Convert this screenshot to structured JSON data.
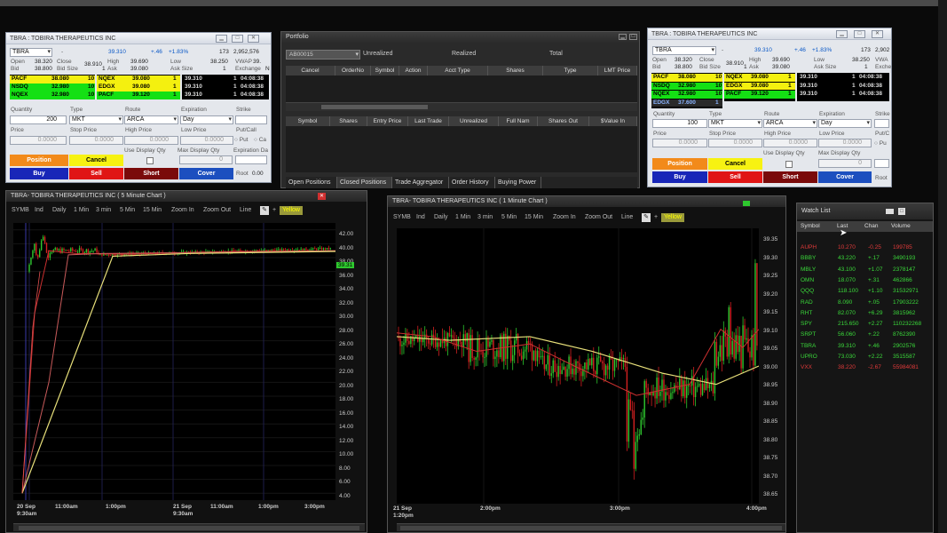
{
  "ticket1": {
    "title": "TBRA : TOBIRA THERAPEUTICS INC",
    "symbol": "TBRA",
    "price": "39.310",
    "change": "+.46",
    "change_pct": "+1.83%",
    "count": "173",
    "volume": "2,952,576",
    "open_label": "Open",
    "open": "38.320",
    "close_label": "Close",
    "close": "38.910",
    "high_label": "High",
    "high": "39.690",
    "low_label": "Low",
    "low": "38.250",
    "vwap_label": "VWAP",
    "vwap": "39.",
    "bid_label": "Bid",
    "bid": "38.800",
    "bidsize_label": "Bid Size",
    "bidsize": "1",
    "ask_label": "Ask",
    "ask": "39.080",
    "asksize_label": "Ask Size",
    "asksize": "1",
    "exch_label": "Exchange",
    "exch": "N",
    "bids": [
      {
        "ex": "PACF",
        "p": "38.080",
        "s": "10"
      },
      {
        "ex": "NSDQ",
        "p": "32.980",
        "s": "10"
      },
      {
        "ex": "NQEX",
        "p": "32.980",
        "s": "10"
      }
    ],
    "asks": [
      {
        "ex": "NQEX",
        "p": "39.080",
        "s": "1"
      },
      {
        "ex": "EDGX",
        "p": "39.080",
        "s": "1"
      },
      {
        "ex": "PACF",
        "p": "39.120",
        "s": "1"
      }
    ],
    "tape": [
      {
        "p": "39.310",
        "s": "1",
        "t": "04:08:38"
      },
      {
        "p": "39.310",
        "s": "1",
        "t": "04:08:38"
      },
      {
        "p": "39.310",
        "s": "1",
        "t": "04:08:38"
      }
    ],
    "qty_label": "Quantity",
    "qty": "200",
    "type_label": "Type",
    "type": "MKT",
    "route_label": "Route",
    "route": "ARCA",
    "exp_label": "Expiration",
    "exp": "Day",
    "strike_label": "Strike",
    "price_label": "Price",
    "price_val": "0.0000",
    "stop_label": "Stop Price",
    "stop_val": "0.0000",
    "hp_label": "High Price",
    "hp_val": "0.0000",
    "lp_label": "Low Price",
    "lp_val": "0.0000",
    "pc_label": "Put/Call",
    "put": "Put",
    "call": "Ca",
    "usedisp_label": "Use Display Qty",
    "maxdisp_label": "Max Display Qty",
    "maxdisp_val": "0",
    "expdate_label": "Expiration Da",
    "position_btn": "Position",
    "cancel_btn": "Cancel",
    "buy_btn": "Buy",
    "sell_btn": "Sell",
    "short_btn": "Short",
    "cover_btn": "Cover",
    "root_label": "Root",
    "root_val": "0.00"
  },
  "ticket2": {
    "title": "TBRA : TOBIRA THERAPEUTICS INC",
    "symbol": "TBRA",
    "price": "39.310",
    "change": "+.46",
    "change_pct": "+1.83%",
    "count": "173",
    "volume": "2,902",
    "open_label": "Open",
    "open": "38.320",
    "close_label": "Close",
    "close": "38.910",
    "high_label": "High",
    "high": "39.690",
    "low_label": "Low",
    "low": "38.250",
    "vwap_label": "VWA",
    "bid_label": "Bid",
    "bid": "38.800",
    "bidsize_label": "Bid Size",
    "bidsize": "1",
    "ask_label": "Ask",
    "ask": "39.080",
    "asksize_label": "Ask Size",
    "asksize": "1",
    "exch_label": "Exche",
    "bids": [
      {
        "ex": "PACF",
        "p": "38.080",
        "s": "10"
      },
      {
        "ex": "NSDQ",
        "p": "32.980",
        "s": "10"
      },
      {
        "ex": "NQEX",
        "p": "32.980",
        "s": "10"
      },
      {
        "ex": "EDGX",
        "p": "37.600",
        "s": "1"
      }
    ],
    "asks": [
      {
        "ex": "NQEX",
        "p": "39.080",
        "s": "1"
      },
      {
        "ex": "EDGX",
        "p": "39.080",
        "s": "1"
      },
      {
        "ex": "PACF",
        "p": "39.120",
        "s": "1"
      }
    ],
    "tape": [
      {
        "p": "39.310",
        "s": "1",
        "t": "04:08:38"
      },
      {
        "p": "39.310",
        "s": "1",
        "t": "04:08:38"
      },
      {
        "p": "39.310",
        "s": "1",
        "t": "04:08:38"
      }
    ],
    "qty_label": "Quantity",
    "qty": "100",
    "type_label": "Type",
    "type": "MKT",
    "route_label": "Route",
    "route": "ARCA",
    "exp_label": "Expiration",
    "exp": "Day",
    "strike_label": "Strike",
    "price_label": "Price",
    "price_val": "0.0000",
    "stop_label": "Stop Price",
    "stop_val": "0.0000",
    "hp_label": "High Price",
    "hp_val": "0.0000",
    "lp_label": "Low Price",
    "lp_val": "0.0000",
    "pc_label": "Put/C",
    "put": "Pu",
    "usedisp_label": "Use Display Qty",
    "maxdisp_label": "Max Display Qty",
    "maxdisp_val": "0",
    "position_btn": "Position",
    "cancel_btn": "Cancel",
    "buy_btn": "Buy",
    "sell_btn": "Sell",
    "short_btn": "Short",
    "cover_btn": "Cover",
    "root_label": "Root"
  },
  "portfolio": {
    "title": "Portfolio",
    "account": "AB00015",
    "unrealized": "Unrealized",
    "realized": "Realized",
    "total": "Total",
    "orders_cols": [
      "Cancel",
      "OrderNo",
      "Symbol",
      "Action",
      "Acct Type",
      "Shares",
      "Type",
      "LMT Price"
    ],
    "pos_cols": [
      "Symbol",
      "Shares",
      "Entry Price",
      "Last Trade",
      "Unrealized",
      "Full Nam",
      "Shares Out",
      "$Value In"
    ],
    "tabs": [
      "Open Positions",
      "Closed Positions",
      "Trade Aggregator",
      "Order History",
      "Buying Power"
    ]
  },
  "chart1": {
    "title": "TBRA- TOBIRA THERAPEUTICS INC ( 5 Minute Chart )",
    "tools": [
      "SYMB",
      "Ind",
      "Daily",
      "1 Min",
      "3 min",
      "5 Min",
      "15 Min",
      "Zoom In",
      "Zoom Out",
      "Line"
    ],
    "color_label": "Yellow",
    "yticks": [
      "42.00",
      "40.00",
      "38.00",
      "36.00",
      "34.00",
      "32.00",
      "30.00",
      "28.00",
      "26.00",
      "24.00",
      "22.00",
      "20.00",
      "18.00",
      "16.00",
      "14.00",
      "12.00",
      "10.00",
      "8.00",
      "6.00",
      "4.00"
    ],
    "last_tag": "39.31",
    "xticks": [
      {
        "l1": "20 Sep",
        "l2": "9:30am"
      },
      {
        "l1": "11:00am",
        "l2": ""
      },
      {
        "l1": "1:00pm",
        "l2": ""
      },
      {
        "l1": "21 Sep",
        "l2": "9:30am"
      },
      {
        "l1": "11:00am",
        "l2": ""
      },
      {
        "l1": "1:00pm",
        "l2": ""
      },
      {
        "l1": "3:00pm",
        "l2": ""
      }
    ]
  },
  "chart2": {
    "title": "TBRA- TOBIRA THERAPEUTICS INC ( 1 Minute Chart )",
    "tools": [
      "SYMB",
      "Ind",
      "Daily",
      "1 Min",
      "3 min",
      "5 Min",
      "15 Min",
      "Zoom In",
      "Zoom Out",
      "Line"
    ],
    "color_label": "Yellow",
    "yticks": [
      "39.35",
      "39.30",
      "39.25",
      "39.20",
      "39.15",
      "39.10",
      "39.05",
      "39.00",
      "38.95",
      "38.90",
      "38.85",
      "38.80",
      "38.75",
      "38.70",
      "38.65"
    ],
    "xticks": [
      {
        "l1": "21 Sep",
        "l2": "1:20pm"
      },
      {
        "l1": "2:00pm",
        "l2": ""
      },
      {
        "l1": "3:00pm",
        "l2": ""
      },
      {
        "l1": "4:00pm",
        "l2": ""
      }
    ]
  },
  "watchlist": {
    "title": "Watch List",
    "cols": [
      "Symbol",
      "Last",
      "Chan",
      "Volume"
    ],
    "rows": [
      {
        "sym": "AUPH",
        "last": "10.270",
        "chg": "-0.25",
        "vol": "199785",
        "color": "#e03a3a"
      },
      {
        "sym": "BBBY",
        "last": "43.220",
        "chg": "+.17",
        "vol": "3490193",
        "color": "#3ad83a"
      },
      {
        "sym": "MBLY",
        "last": "43.100",
        "chg": "+1.07",
        "vol": "2378147",
        "color": "#3ad83a"
      },
      {
        "sym": "OMN",
        "last": "18.070",
        "chg": "+.31",
        "vol": "462866",
        "color": "#3ad83a"
      },
      {
        "sym": "QQQ",
        "last": "118.100",
        "chg": "+1.10",
        "vol": "31532971",
        "color": "#3ad83a"
      },
      {
        "sym": "RAD",
        "last": "8.090",
        "chg": "+.05",
        "vol": "17903222",
        "color": "#3ad83a"
      },
      {
        "sym": "RHT",
        "last": "82.070",
        "chg": "+6.29",
        "vol": "3815962",
        "color": "#3ad83a"
      },
      {
        "sym": "SPY",
        "last": "215.650",
        "chg": "+2.27",
        "vol": "110232268",
        "color": "#3ad83a"
      },
      {
        "sym": "SRPT",
        "last": "56.060",
        "chg": "+.22",
        "vol": "8762390",
        "color": "#3ad83a"
      },
      {
        "sym": "TBRA",
        "last": "39.310",
        "chg": "+.46",
        "vol": "2902576",
        "color": "#3ad83a"
      },
      {
        "sym": "UPRO",
        "last": "73.030",
        "chg": "+2.22",
        "vol": "3515587",
        "color": "#3ad83a"
      },
      {
        "sym": "VXX",
        "last": "38.220",
        "chg": "-2.67",
        "vol": "55984081",
        "color": "#e03a3a"
      }
    ]
  },
  "colors": {
    "position": "#f28a1a",
    "cancel": "#f7f212",
    "buy": "#1826b8",
    "sell": "#e01515",
    "short": "#7a0a0a",
    "cover": "#1c4fbf",
    "bid_row": "#f4f00f",
    "bid_row2": "#14e014",
    "ask_row": "#f4f00f",
    "ask_row2": "#14e014",
    "candle_up": "#2ec82e",
    "candle_down": "#d42020",
    "ma_yellow": "#e8e07a",
    "ma_red": "#cc3030"
  }
}
